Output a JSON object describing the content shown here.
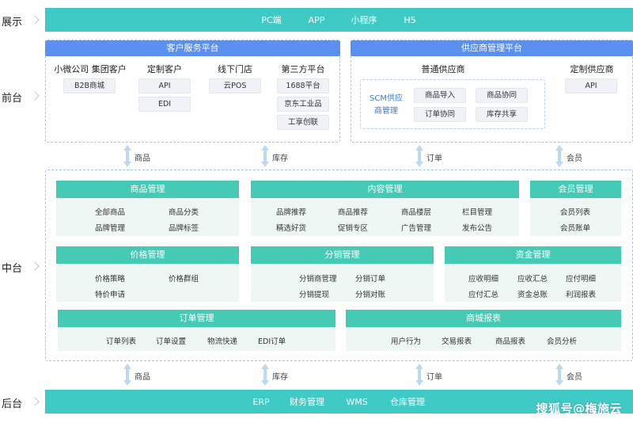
{
  "rows": {
    "display": "展示",
    "front": "前台",
    "middle": "中台",
    "back": "后台"
  },
  "display_bar": [
    "PC端",
    "APP",
    "小程序",
    "H5"
  ],
  "customer_platform": {
    "title": "客户服务平台",
    "columns": [
      {
        "label": "小微公司 集团客户",
        "chips": [
          "B2B商城"
        ]
      },
      {
        "label": "定制客户",
        "chips": [
          "API",
          "EDI"
        ]
      },
      {
        "label": "线下门店",
        "chips": [
          "云POS"
        ]
      },
      {
        "label": "第三方平台",
        "chips": [
          "1688平台",
          "京东工业品",
          "工享创联"
        ]
      }
    ]
  },
  "supply_platform": {
    "title": "供应商管理平台",
    "general_label": "普通供应商",
    "custom_label": "定制供应商",
    "scm": "SCM供应\n商管理",
    "chips": [
      "商品导入",
      "商品协同",
      "订单协同",
      "库存共享"
    ],
    "custom_chip": "API"
  },
  "upper_connectors": [
    "商品",
    "库存",
    "订单",
    "会员"
  ],
  "lower_connectors": [
    "商品",
    "库存",
    "订单",
    "会员"
  ],
  "modules": {
    "product": {
      "title": "商品管理",
      "items": [
        "全部商品",
        "商品分类",
        "品牌管理",
        "品牌标签"
      ]
    },
    "content": {
      "title": "内容管理",
      "items": [
        "品牌推荐",
        "商品推荐",
        "商品楼层",
        "栏目管理",
        "精选好货",
        "促销专区",
        "广告管理",
        "发布公告"
      ]
    },
    "member": {
      "title": "会员管理",
      "items": [
        "会员列表",
        "会员账单"
      ]
    },
    "price": {
      "title": "价格管理",
      "items": [
        "价格策略",
        "价格群组",
        "特价申请"
      ]
    },
    "distribution": {
      "title": "分销管理",
      "items": [
        "分销商管理",
        "分销订单",
        "分销提现",
        "分销对账"
      ]
    },
    "finance": {
      "title": "资金管理",
      "items": [
        "应收明细",
        "应收汇总",
        "应付明细",
        "应付汇总",
        "资金总账",
        "利润报表"
      ]
    },
    "order": {
      "title": "订单管理",
      "items": [
        "订单列表",
        "订单设置",
        "物流快递",
        "EDI订单"
      ]
    },
    "report": {
      "title": "商城报表",
      "items": [
        "用户行为",
        "交易报表",
        "商品报表",
        "会员分析"
      ]
    }
  },
  "back_bar": [
    "ERP",
    "财务管理",
    "WMS",
    "仓库管理"
  ],
  "watermark": "搜狐号@梅施云",
  "colors": {
    "teal": "#3fcac5",
    "module_head": "#45cbb5",
    "blue_head": "#5b8ff0",
    "module_body": "#eef7f4"
  }
}
